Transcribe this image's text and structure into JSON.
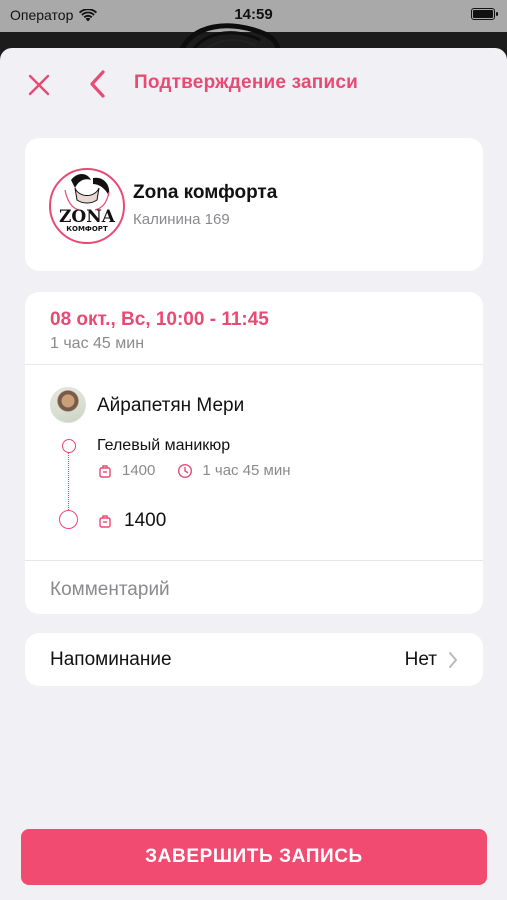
{
  "status_bar": {
    "carrier": "Оператор",
    "time": "14:59"
  },
  "nav": {
    "title": "Подтверждение записи"
  },
  "salon": {
    "name": "Zona комфорта",
    "address": "Калинина 169",
    "logo_text": "ZONA",
    "logo_subtext": "КОМФОРТ"
  },
  "booking": {
    "date_time": "08 окт., Вс, 10:00 - 11:45",
    "duration": "1 час 45 мин",
    "master": {
      "name": "Айрапетян Мери"
    },
    "service": {
      "name": "Гелевый маникюр",
      "price": "1400",
      "duration": "1 час 45 мин"
    },
    "total": "1400",
    "comment_placeholder": "Комментарий"
  },
  "reminder": {
    "label": "Напоминание",
    "value": "Нет"
  },
  "finish_button": {
    "label": "ЗАВЕРШИТЬ ЗАПИСЬ"
  },
  "colors": {
    "accent": "#e84a74",
    "button": "#f24b72",
    "sheet_bg": "#f1f0f5",
    "muted_text": "#8a8a8e"
  },
  "icons": [
    "wifi-icon",
    "battery-icon",
    "close-icon",
    "chevron-left-icon",
    "price-tag-icon",
    "clock-icon",
    "chevron-right-icon"
  ]
}
